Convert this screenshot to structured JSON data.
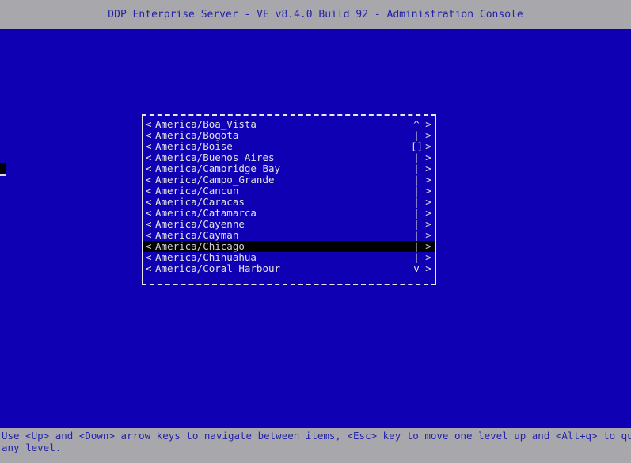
{
  "titlebar": {
    "title": "DDP Enterprise Server - VE v8.4.0 Build 92 - Administration Console"
  },
  "colors": {
    "background": "#0f00b4",
    "chrome": "#a8a8ac",
    "chrome_text": "#2222a8",
    "list_text": "#e4e4e4",
    "selection_bg": "#000000",
    "selection_text": "#d0d0d0",
    "border": "#e8e8e8"
  },
  "listbox": {
    "marker_left": "<",
    "marker_right": ">",
    "scroll_up_glyph": "^",
    "scroll_down_glyph": "v",
    "scroll_track_glyph": "|",
    "scroll_thumb_glyph": "[]",
    "selected_index": 11,
    "items": [
      {
        "label": "America/Boa_Vista",
        "scroll": "^"
      },
      {
        "label": "America/Bogota",
        "scroll": "|"
      },
      {
        "label": "America/Boise",
        "scroll": "[]"
      },
      {
        "label": "America/Buenos_Aires",
        "scroll": "|"
      },
      {
        "label": "America/Cambridge_Bay",
        "scroll": "|"
      },
      {
        "label": "America/Campo_Grande",
        "scroll": "|"
      },
      {
        "label": "America/Cancun",
        "scroll": "|"
      },
      {
        "label": "America/Caracas",
        "scroll": "|"
      },
      {
        "label": "America/Catamarca",
        "scroll": "|"
      },
      {
        "label": "America/Cayenne",
        "scroll": "|"
      },
      {
        "label": "America/Cayman",
        "scroll": "|"
      },
      {
        "label": "America/Chicago",
        "scroll": "|"
      },
      {
        "label": "America/Chihuahua",
        "scroll": "|"
      },
      {
        "label": "America/Coral_Harbour",
        "scroll": "v"
      }
    ]
  },
  "footer": {
    "line1": "Use <Up> and <Down> arrow keys to navigate between items, <Esc> key to move one level up and <Alt+q> to quit at",
    "line2": "any level."
  }
}
